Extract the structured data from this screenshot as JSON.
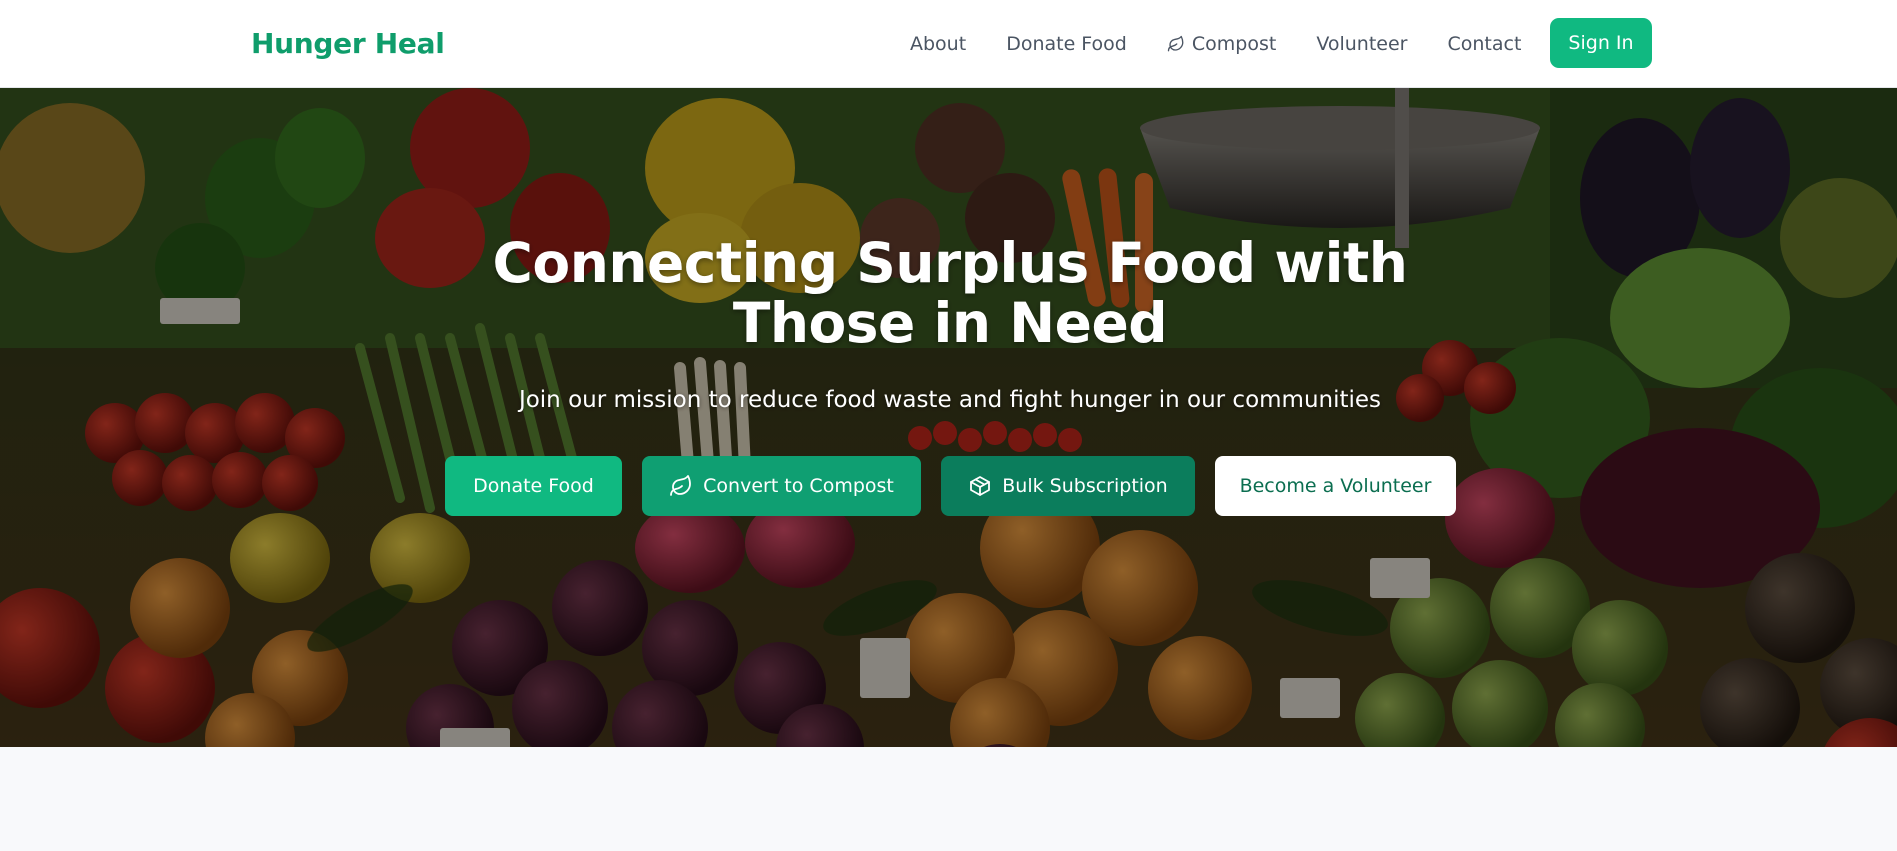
{
  "header": {
    "brand": "Hunger Heal",
    "nav": [
      {
        "label": "About",
        "icon": null
      },
      {
        "label": "Donate Food",
        "icon": null
      },
      {
        "label": "Compost",
        "icon": "leaf-icon"
      },
      {
        "label": "Volunteer",
        "icon": null
      },
      {
        "label": "Contact",
        "icon": null
      }
    ],
    "signin_label": "Sign In"
  },
  "hero": {
    "title": "Connecting Surplus Food with Those in Need",
    "subtitle": "Join our mission to reduce food waste and fight hunger in our communities",
    "buttons": {
      "donate": "Donate Food",
      "compost": "Convert to Compost",
      "bulk": "Bulk Subscription",
      "volunteer": "Become a Volunteer"
    },
    "background": "market-produce-photo"
  },
  "colors": {
    "brand": "#0f9d6b",
    "primary": "#10b981",
    "compost": "#0f9f72",
    "bulk": "#0b7d5c",
    "nav_text": "#4b5563",
    "page_bg": "#f8f9fb"
  }
}
